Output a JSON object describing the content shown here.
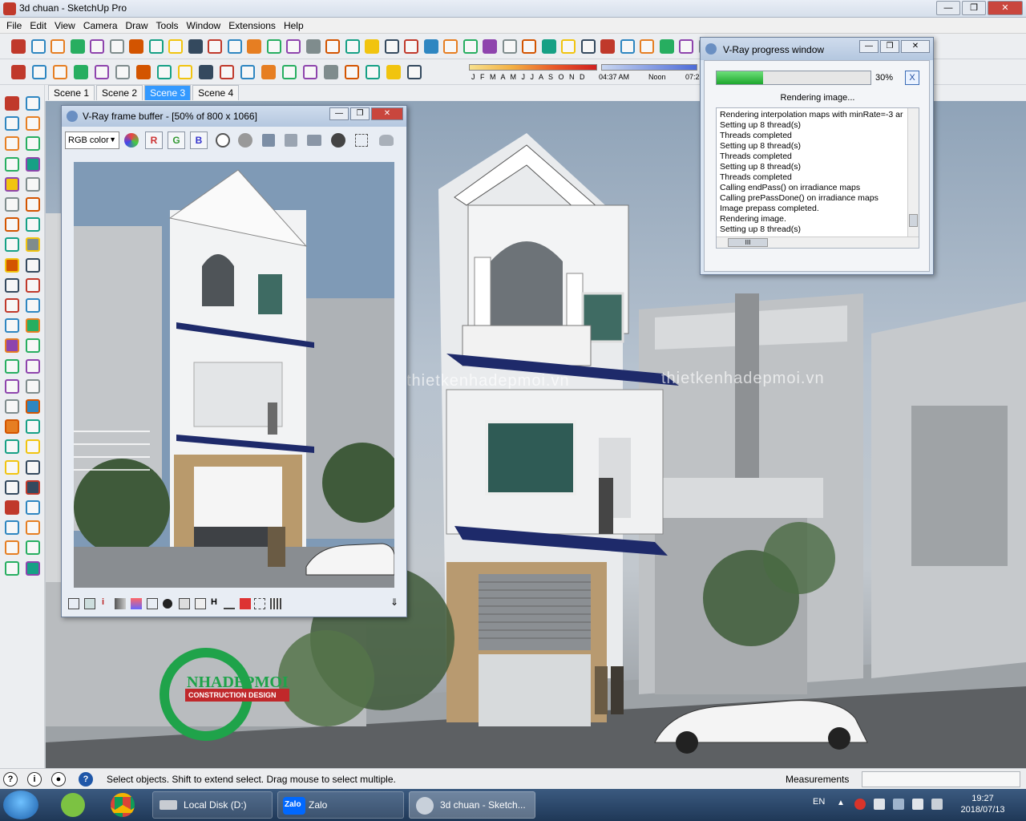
{
  "window": {
    "title": "3d chuan - SketchUp Pro"
  },
  "menu": [
    "File",
    "Edit",
    "View",
    "Camera",
    "Draw",
    "Tools",
    "Window",
    "Extensions",
    "Help"
  ],
  "shadow": {
    "months": "J F M A M J J A S O N D",
    "time_start": "04:37 AM",
    "time_noon": "Noon",
    "time_end": "07:2"
  },
  "scenes": [
    {
      "label": "Scene 1",
      "active": false
    },
    {
      "label": "Scene 2",
      "active": false
    },
    {
      "label": "Scene 3",
      "active": true
    },
    {
      "label": "Scene 4",
      "active": false
    }
  ],
  "watermark": "thietkenhadepmoi.vn",
  "logo": {
    "name": "NHADEPMOI",
    "tagline": "CONSTRUCTION DESIGN"
  },
  "vfb": {
    "title": "V-Ray frame buffer - [50% of 800 x 1066]",
    "channel_select": "RGB color",
    "channels": [
      "R",
      "G",
      "B"
    ]
  },
  "vpw": {
    "title": "V-Ray progress window",
    "progress": 30,
    "progress_label": "30%",
    "cancel_label": "X",
    "status": "Rendering image...",
    "log": [
      "Rendering interpolation maps with minRate=-3 ar",
      "Setting up 8 thread(s)",
      "Threads completed",
      "Setting up 8 thread(s)",
      "Threads completed",
      "Setting up 8 thread(s)",
      "Threads completed",
      "Calling endPass() on irradiance maps",
      "Calling prePassDone() on irradiance maps",
      "Image prepass completed.",
      "Rendering image.",
      "Setting up 8 thread(s)"
    ],
    "hscroll_label": "III"
  },
  "status": {
    "message": "Select objects. Shift to extend select. Drag mouse to select multiple.",
    "measurements_label": "Measurements"
  },
  "taskbar": {
    "items": [
      {
        "label": "Local Disk (D:)"
      },
      {
        "label": "Zalo"
      },
      {
        "label": "3d chuan - Sketch..."
      }
    ],
    "zalo_badge": "Zalo",
    "language": "EN",
    "time": "19:27",
    "date": "2018/07/13"
  },
  "colors": {
    "accent": "#3399ff",
    "progress_green": "#1da62d",
    "logo_green": "#1fa34a",
    "logo_red": "#c0282b"
  }
}
